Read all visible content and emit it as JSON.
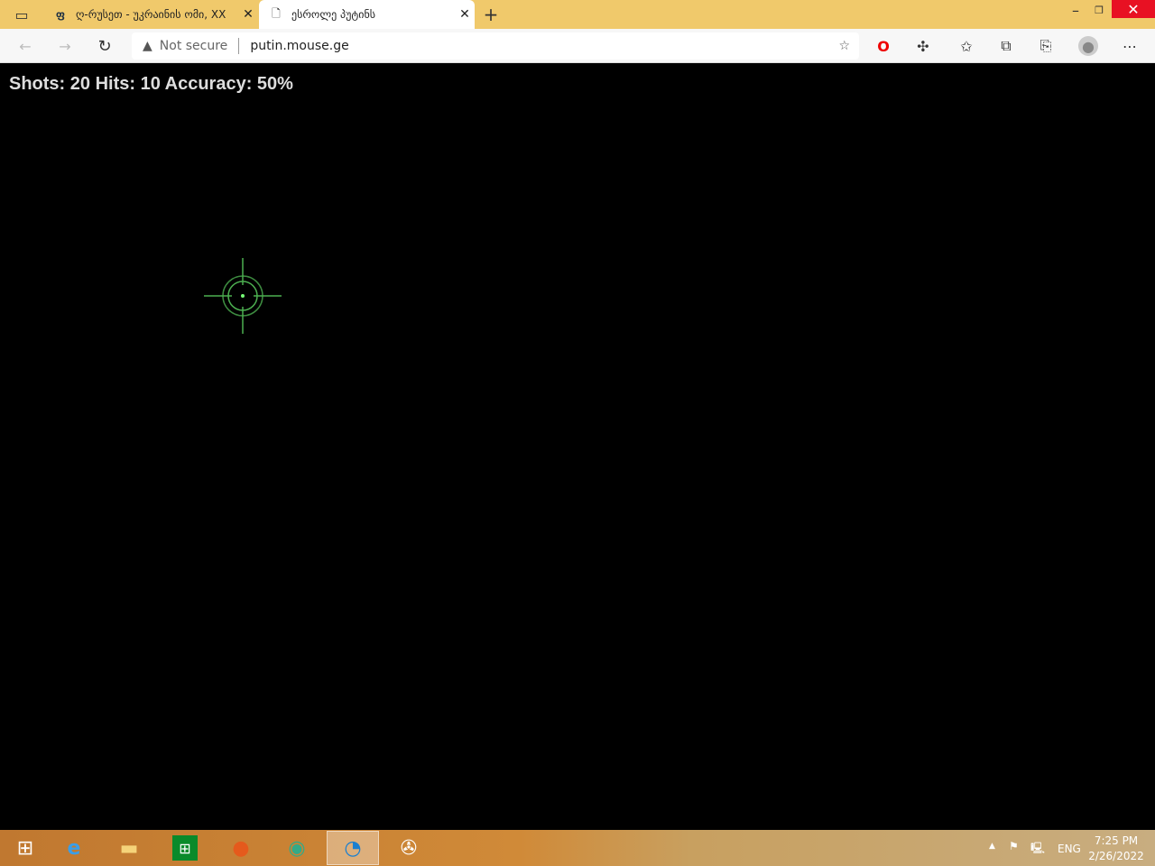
{
  "browser": {
    "tabs": [
      {
        "title": "ღ-რუსეთ - უკრაინის ომი, XX",
        "icon": "georgian-logo-icon",
        "active": false
      },
      {
        "title": "ესროლე პუტინს",
        "icon": "page-icon",
        "active": true
      }
    ],
    "security_label": "Not secure",
    "url": "putin.mouse.ge"
  },
  "game": {
    "stats": "Shots: 20 Hits: 10 Accuracy: 50%",
    "shots": 20,
    "hits": 10,
    "accuracy_percent": 50,
    "crosshair_color": "#4caf50"
  },
  "taskbar": {
    "language": "ENG",
    "time": "7:25 PM",
    "date": "2/26/2022"
  }
}
